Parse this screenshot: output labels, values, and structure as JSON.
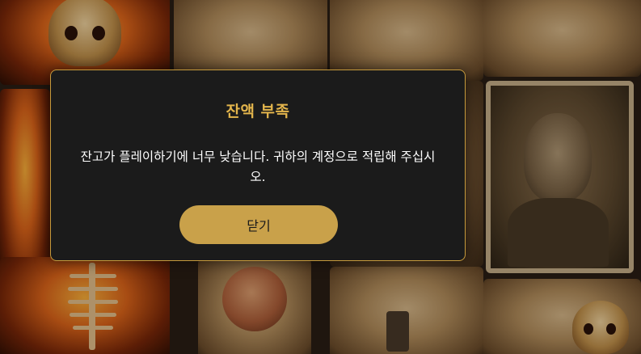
{
  "dialog": {
    "title": "잔액 부족",
    "message": "잔고가 플레이하기에 너무 낮습니다. 귀하의 계정으로 적립해 주십시오.",
    "close_label": "닫기"
  },
  "colors": {
    "accent": "#c9a14a",
    "title": "#e3b54c",
    "dialog_bg": "#1b1b1b",
    "border": "#c69a3c"
  },
  "background": {
    "icons": [
      "skull-icon",
      "ribcage-icon",
      "girl-portrait-icon",
      "skull-icon",
      "brain-jar-icon",
      "pistol-icon"
    ]
  }
}
